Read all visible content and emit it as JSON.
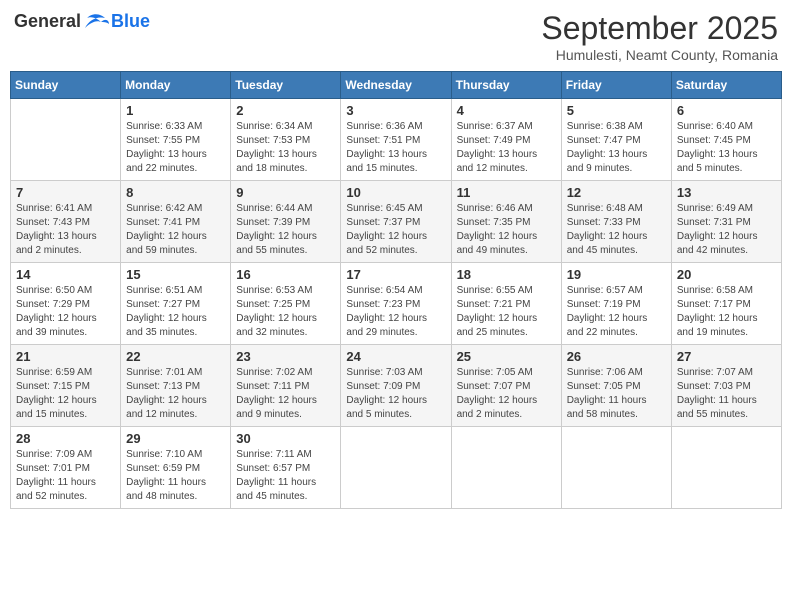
{
  "header": {
    "logo_general": "General",
    "logo_blue": "Blue",
    "month_title": "September 2025",
    "subtitle": "Humulesti, Neamt County, Romania"
  },
  "days_of_week": [
    "Sunday",
    "Monday",
    "Tuesday",
    "Wednesday",
    "Thursday",
    "Friday",
    "Saturday"
  ],
  "weeks": [
    [
      {
        "day": "",
        "info": ""
      },
      {
        "day": "1",
        "info": "Sunrise: 6:33 AM\nSunset: 7:55 PM\nDaylight: 13 hours\nand 22 minutes."
      },
      {
        "day": "2",
        "info": "Sunrise: 6:34 AM\nSunset: 7:53 PM\nDaylight: 13 hours\nand 18 minutes."
      },
      {
        "day": "3",
        "info": "Sunrise: 6:36 AM\nSunset: 7:51 PM\nDaylight: 13 hours\nand 15 minutes."
      },
      {
        "day": "4",
        "info": "Sunrise: 6:37 AM\nSunset: 7:49 PM\nDaylight: 13 hours\nand 12 minutes."
      },
      {
        "day": "5",
        "info": "Sunrise: 6:38 AM\nSunset: 7:47 PM\nDaylight: 13 hours\nand 9 minutes."
      },
      {
        "day": "6",
        "info": "Sunrise: 6:40 AM\nSunset: 7:45 PM\nDaylight: 13 hours\nand 5 minutes."
      }
    ],
    [
      {
        "day": "7",
        "info": "Sunrise: 6:41 AM\nSunset: 7:43 PM\nDaylight: 13 hours\nand 2 minutes."
      },
      {
        "day": "8",
        "info": "Sunrise: 6:42 AM\nSunset: 7:41 PM\nDaylight: 12 hours\nand 59 minutes."
      },
      {
        "day": "9",
        "info": "Sunrise: 6:44 AM\nSunset: 7:39 PM\nDaylight: 12 hours\nand 55 minutes."
      },
      {
        "day": "10",
        "info": "Sunrise: 6:45 AM\nSunset: 7:37 PM\nDaylight: 12 hours\nand 52 minutes."
      },
      {
        "day": "11",
        "info": "Sunrise: 6:46 AM\nSunset: 7:35 PM\nDaylight: 12 hours\nand 49 minutes."
      },
      {
        "day": "12",
        "info": "Sunrise: 6:48 AM\nSunset: 7:33 PM\nDaylight: 12 hours\nand 45 minutes."
      },
      {
        "day": "13",
        "info": "Sunrise: 6:49 AM\nSunset: 7:31 PM\nDaylight: 12 hours\nand 42 minutes."
      }
    ],
    [
      {
        "day": "14",
        "info": "Sunrise: 6:50 AM\nSunset: 7:29 PM\nDaylight: 12 hours\nand 39 minutes."
      },
      {
        "day": "15",
        "info": "Sunrise: 6:51 AM\nSunset: 7:27 PM\nDaylight: 12 hours\nand 35 minutes."
      },
      {
        "day": "16",
        "info": "Sunrise: 6:53 AM\nSunset: 7:25 PM\nDaylight: 12 hours\nand 32 minutes."
      },
      {
        "day": "17",
        "info": "Sunrise: 6:54 AM\nSunset: 7:23 PM\nDaylight: 12 hours\nand 29 minutes."
      },
      {
        "day": "18",
        "info": "Sunrise: 6:55 AM\nSunset: 7:21 PM\nDaylight: 12 hours\nand 25 minutes."
      },
      {
        "day": "19",
        "info": "Sunrise: 6:57 AM\nSunset: 7:19 PM\nDaylight: 12 hours\nand 22 minutes."
      },
      {
        "day": "20",
        "info": "Sunrise: 6:58 AM\nSunset: 7:17 PM\nDaylight: 12 hours\nand 19 minutes."
      }
    ],
    [
      {
        "day": "21",
        "info": "Sunrise: 6:59 AM\nSunset: 7:15 PM\nDaylight: 12 hours\nand 15 minutes."
      },
      {
        "day": "22",
        "info": "Sunrise: 7:01 AM\nSunset: 7:13 PM\nDaylight: 12 hours\nand 12 minutes."
      },
      {
        "day": "23",
        "info": "Sunrise: 7:02 AM\nSunset: 7:11 PM\nDaylight: 12 hours\nand 9 minutes."
      },
      {
        "day": "24",
        "info": "Sunrise: 7:03 AM\nSunset: 7:09 PM\nDaylight: 12 hours\nand 5 minutes."
      },
      {
        "day": "25",
        "info": "Sunrise: 7:05 AM\nSunset: 7:07 PM\nDaylight: 12 hours\nand 2 minutes."
      },
      {
        "day": "26",
        "info": "Sunrise: 7:06 AM\nSunset: 7:05 PM\nDaylight: 11 hours\nand 58 minutes."
      },
      {
        "day": "27",
        "info": "Sunrise: 7:07 AM\nSunset: 7:03 PM\nDaylight: 11 hours\nand 55 minutes."
      }
    ],
    [
      {
        "day": "28",
        "info": "Sunrise: 7:09 AM\nSunset: 7:01 PM\nDaylight: 11 hours\nand 52 minutes."
      },
      {
        "day": "29",
        "info": "Sunrise: 7:10 AM\nSunset: 6:59 PM\nDaylight: 11 hours\nand 48 minutes."
      },
      {
        "day": "30",
        "info": "Sunrise: 7:11 AM\nSunset: 6:57 PM\nDaylight: 11 hours\nand 45 minutes."
      },
      {
        "day": "",
        "info": ""
      },
      {
        "day": "",
        "info": ""
      },
      {
        "day": "",
        "info": ""
      },
      {
        "day": "",
        "info": ""
      }
    ]
  ]
}
